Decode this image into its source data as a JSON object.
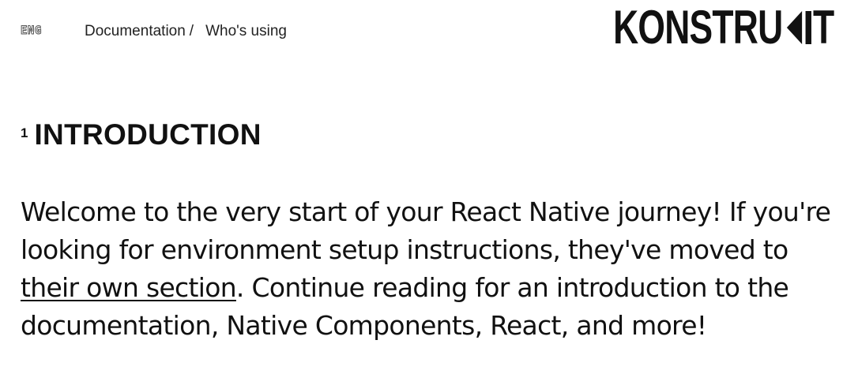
{
  "header": {
    "language": "ENG",
    "breadcrumb": {
      "parent": "Documentation",
      "separator": "/",
      "current": "Who's using"
    },
    "logo": {
      "text_start": "KONSTRU",
      "text_end": "T",
      "mark_icon": "arrow-k-logo-icon"
    }
  },
  "main": {
    "section_number": "1",
    "section_title": "INTRODUCTION",
    "paragraph": {
      "text_before_link": "Welcome to the very start of your React Native journey! If you're looking for environment setup instructions, they've moved to ",
      "link_text": "their own section",
      "text_after_link": ". Continue reading for an introduction to the documentation, Native Components, React, and more!"
    }
  },
  "colors": {
    "text": "#111111",
    "background": "#ffffff"
  }
}
